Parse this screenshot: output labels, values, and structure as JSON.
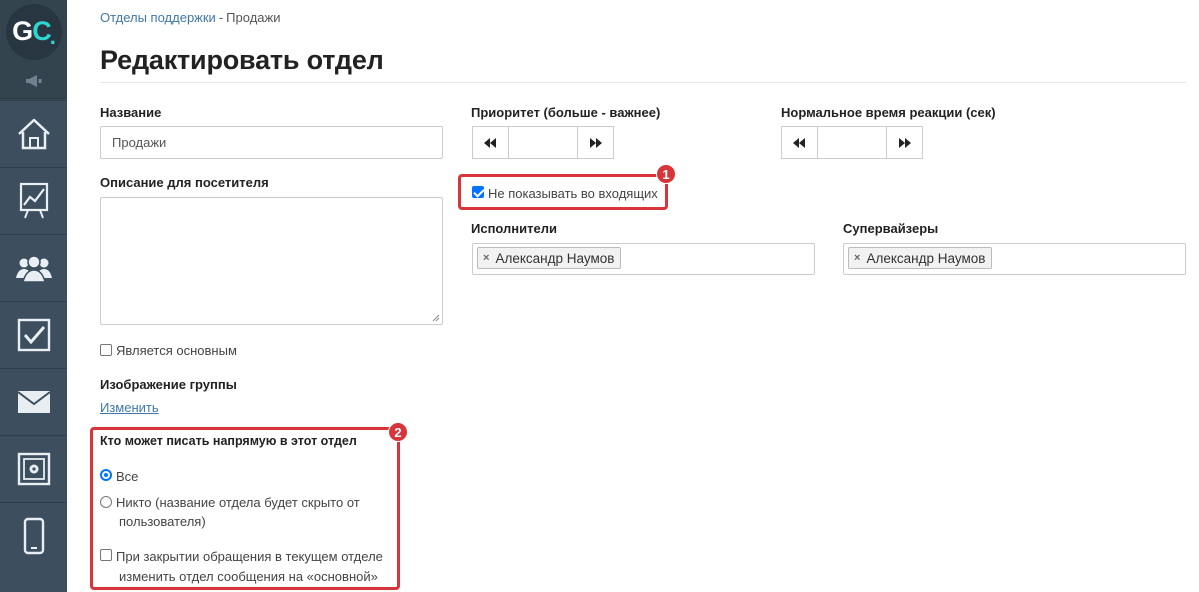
{
  "sidebar": {
    "logo": {
      "letter_g": "G",
      "letter_c": "C",
      "dot": "."
    },
    "items": [
      {
        "icon": "home-icon"
      },
      {
        "icon": "chart-icon"
      },
      {
        "icon": "users-icon"
      },
      {
        "icon": "tasks-icon"
      },
      {
        "icon": "mail-icon"
      },
      {
        "icon": "safe-icon"
      },
      {
        "icon": "mobile-icon"
      }
    ]
  },
  "breadcrumb": {
    "parent": "Отделы поддержки",
    "separator": "-",
    "current": "Продажи"
  },
  "page_title": "Редактировать отдел",
  "form": {
    "name": {
      "label": "Название",
      "value": "Продажи"
    },
    "description": {
      "label": "Описание для посетителя",
      "value": ""
    },
    "is_main": {
      "label": "Является основным",
      "checked": false
    },
    "group_image": {
      "label": "Изображение группы",
      "change_link": "Изменить"
    },
    "priority": {
      "label": "Приоритет (больше - важнее)",
      "value": ""
    },
    "reaction_time": {
      "label": "Нормальное время реакции (сек)",
      "value": ""
    },
    "hide_inbox": {
      "label": "Не показывать во входящих",
      "checked": true
    },
    "executors": {
      "label": "Исполнители",
      "tags": [
        "Александр Наумов"
      ]
    },
    "supervisors": {
      "label": "Супервайзеры",
      "tags": [
        "Александр Наумов"
      ]
    },
    "who_can_write": {
      "label": "Кто может писать напрямую в этот отдел",
      "options": [
        {
          "label": "Все",
          "selected": true
        },
        {
          "label_line1": "Никто (название отдела будет скрыто от",
          "label_line2": "пользователя)",
          "selected": false
        }
      ],
      "on_close": {
        "label_line1": "При закрытии обращения в текущем отделе",
        "label_line2": "изменить отдел сообщения на «основной»",
        "checked": false
      }
    }
  },
  "annotations": {
    "badge1": "1",
    "badge2": "2",
    "color": "#d9343a"
  },
  "colors": {
    "sidebar": "#3d4f5f",
    "accent": "#3f77a8",
    "check": "#0075ff"
  }
}
